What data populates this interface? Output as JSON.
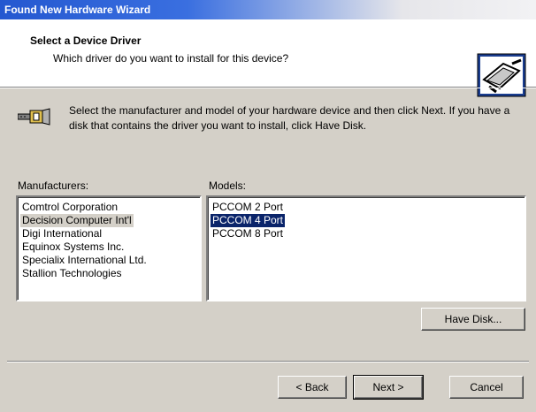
{
  "window": {
    "title": "Found New Hardware Wizard"
  },
  "header": {
    "title": "Select a Device Driver",
    "subtitle": "Which driver do you want to install for this device?"
  },
  "intro": {
    "text": "Select the manufacturer and model of your hardware device and then click Next. If you have a disk that contains the driver you want to install, click Have Disk."
  },
  "manufacturers": {
    "label": "Manufacturers:",
    "items": [
      "Comtrol Corporation",
      "Decision Computer Int'l",
      "Digi International",
      "Equinox Systems Inc.",
      "Specialix International Ltd.",
      "Stallion Technologies"
    ],
    "selected": "Decision Computer Int'l"
  },
  "models": {
    "label": "Models:",
    "items": [
      "PCCOM 2 Port",
      "PCCOM 4 Port",
      "PCCOM 8 Port"
    ],
    "selected": "PCCOM 4 Port"
  },
  "buttons": {
    "have_disk": "Have Disk...",
    "back": "< Back",
    "next": "Next >",
    "cancel": "Cancel"
  },
  "colors": {
    "selection": "#0a246a",
    "face": "#d4d0c8",
    "titlebar": "#2458d0"
  }
}
